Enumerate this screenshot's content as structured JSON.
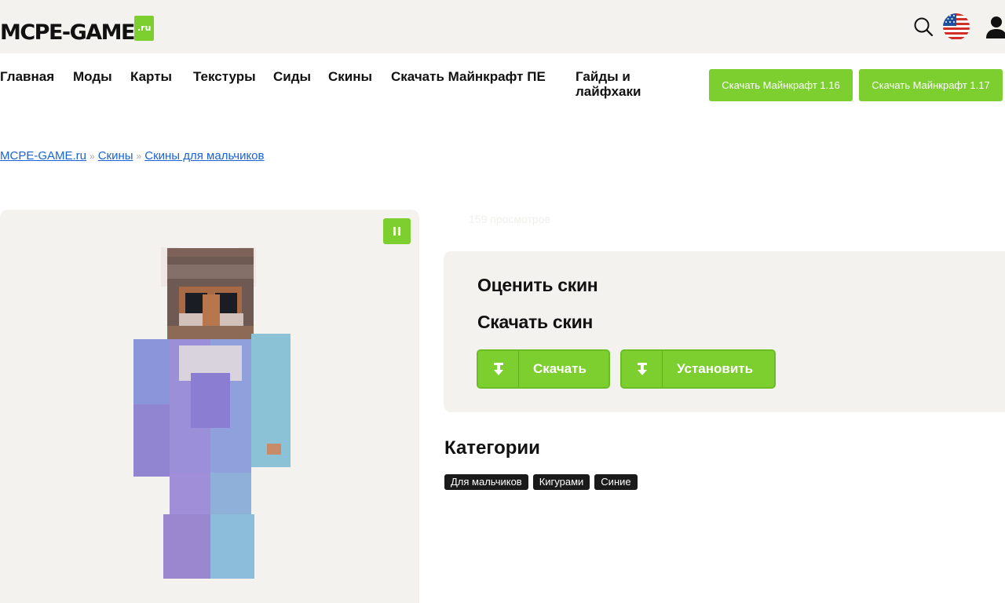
{
  "header": {
    "logo_text": "MCPE-GAME",
    "logo_suffix": ".ru",
    "icons": [
      "search-icon",
      "flag-us-icon",
      "user-icon"
    ]
  },
  "nav": {
    "items": [
      "Главная",
      "Моды",
      "Карты",
      "Текстуры",
      "Сиды",
      "Скины",
      "Скачать Майнкрафт ПЕ",
      "Гайды и лайфхаки"
    ],
    "buttons": [
      "Скачать Майнкрафт 1.16",
      "Скачать Майнкрафт 1.17"
    ]
  },
  "breadcrumb": {
    "items": [
      "MCPE-GAME.ru",
      "Скины",
      "Скины для мальчиков"
    ],
    "separator": "»"
  },
  "preview": {
    "pause_icon": "pause-icon"
  },
  "views_text": "159 просмотров",
  "actions": {
    "rate_title": "Оценить скин",
    "download_title": "Скачать скин",
    "download_label": "Скачать",
    "install_label": "Установить"
  },
  "categories": {
    "title": "Категории",
    "tags": [
      "Для мальчиков",
      "Кигурами",
      "Синие"
    ]
  },
  "colors": {
    "accent": "#7ccf2f",
    "panel_bg": "#f4f2ee",
    "link": "#1a63d6",
    "tag_bg": "#1a1a1a"
  }
}
